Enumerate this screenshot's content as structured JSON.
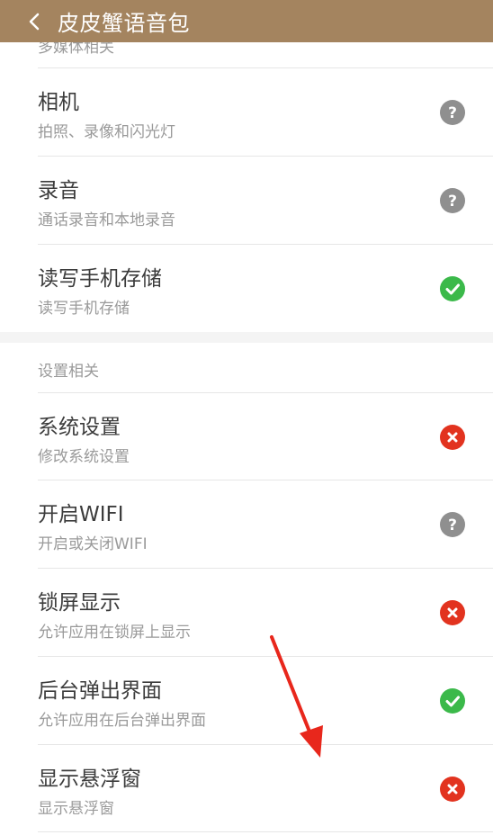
{
  "header": {
    "title": "皮皮蟹语音包",
    "back_icon": "chevron-left-icon",
    "background": "#a4845f"
  },
  "sections": [
    {
      "title": "多媒体相关",
      "items": [
        {
          "title": "相机",
          "subtitle": "拍照、录像和闪光灯",
          "status": "unknown",
          "icon": "question-icon"
        },
        {
          "title": "录音",
          "subtitle": "通话录音和本地录音",
          "status": "unknown",
          "icon": "question-icon"
        },
        {
          "title": "读写手机存储",
          "subtitle": "读写手机存储",
          "status": "granted",
          "icon": "check-icon"
        }
      ]
    },
    {
      "title": "设置相关",
      "items": [
        {
          "title": "系统设置",
          "subtitle": "修改系统设置",
          "status": "denied",
          "icon": "cross-icon"
        },
        {
          "title": "开启WIFI",
          "subtitle": "开启或关闭WIFI",
          "status": "unknown",
          "icon": "question-icon"
        },
        {
          "title": "锁屏显示",
          "subtitle": "允许应用在锁屏上显示",
          "status": "denied",
          "icon": "cross-icon"
        },
        {
          "title": "后台弹出界面",
          "subtitle": "允许应用在后台弹出界面",
          "status": "granted",
          "icon": "check-icon"
        },
        {
          "title": "显示悬浮窗",
          "subtitle": "显示悬浮窗",
          "status": "denied",
          "icon": "cross-icon"
        }
      ]
    }
  ],
  "colors": {
    "unknown": "#8f8f8f",
    "granted": "#3bb94a",
    "denied": "#e2331f",
    "annotation_arrow": "#e8271c"
  },
  "annotation": {
    "icon": "red-arrow-icon"
  }
}
